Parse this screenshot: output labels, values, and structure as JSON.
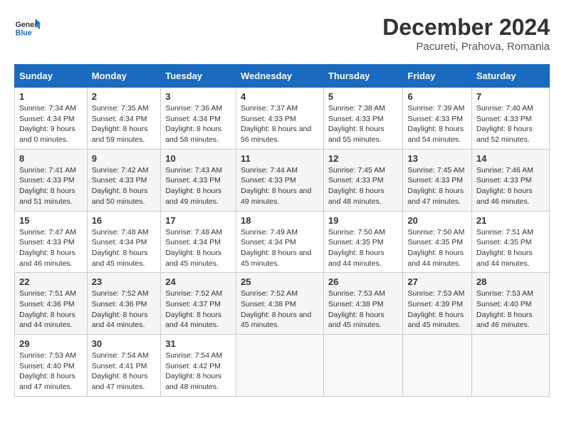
{
  "header": {
    "logo_line1": "General",
    "logo_line2": "Blue",
    "title": "December 2024",
    "subtitle": "Pacureti, Prahova, Romania"
  },
  "columns": [
    "Sunday",
    "Monday",
    "Tuesday",
    "Wednesday",
    "Thursday",
    "Friday",
    "Saturday"
  ],
  "weeks": [
    [
      {
        "day": "1",
        "info": "Sunrise: 7:34 AM\nSunset: 4:34 PM\nDaylight: 9 hours\nand 0 minutes."
      },
      {
        "day": "2",
        "info": "Sunrise: 7:35 AM\nSunset: 4:34 PM\nDaylight: 8 hours\nand 59 minutes."
      },
      {
        "day": "3",
        "info": "Sunrise: 7:36 AM\nSunset: 4:34 PM\nDaylight: 8 hours\nand 58 minutes."
      },
      {
        "day": "4",
        "info": "Sunrise: 7:37 AM\nSunset: 4:33 PM\nDaylight: 8 hours\nand 56 minutes."
      },
      {
        "day": "5",
        "info": "Sunrise: 7:38 AM\nSunset: 4:33 PM\nDaylight: 8 hours\nand 55 minutes."
      },
      {
        "day": "6",
        "info": "Sunrise: 7:39 AM\nSunset: 4:33 PM\nDaylight: 8 hours\nand 54 minutes."
      },
      {
        "day": "7",
        "info": "Sunrise: 7:40 AM\nSunset: 4:33 PM\nDaylight: 8 hours\nand 52 minutes."
      }
    ],
    [
      {
        "day": "8",
        "info": "Sunrise: 7:41 AM\nSunset: 4:33 PM\nDaylight: 8 hours\nand 51 minutes."
      },
      {
        "day": "9",
        "info": "Sunrise: 7:42 AM\nSunset: 4:33 PM\nDaylight: 8 hours\nand 50 minutes."
      },
      {
        "day": "10",
        "info": "Sunrise: 7:43 AM\nSunset: 4:33 PM\nDaylight: 8 hours\nand 49 minutes."
      },
      {
        "day": "11",
        "info": "Sunrise: 7:44 AM\nSunset: 4:33 PM\nDaylight: 8 hours\nand 49 minutes."
      },
      {
        "day": "12",
        "info": "Sunrise: 7:45 AM\nSunset: 4:33 PM\nDaylight: 8 hours\nand 48 minutes."
      },
      {
        "day": "13",
        "info": "Sunrise: 7:45 AM\nSunset: 4:33 PM\nDaylight: 8 hours\nand 47 minutes."
      },
      {
        "day": "14",
        "info": "Sunrise: 7:46 AM\nSunset: 4:33 PM\nDaylight: 8 hours\nand 46 minutes."
      }
    ],
    [
      {
        "day": "15",
        "info": "Sunrise: 7:47 AM\nSunset: 4:33 PM\nDaylight: 8 hours\nand 46 minutes."
      },
      {
        "day": "16",
        "info": "Sunrise: 7:48 AM\nSunset: 4:34 PM\nDaylight: 8 hours\nand 45 minutes."
      },
      {
        "day": "17",
        "info": "Sunrise: 7:48 AM\nSunset: 4:34 PM\nDaylight: 8 hours\nand 45 minutes."
      },
      {
        "day": "18",
        "info": "Sunrise: 7:49 AM\nSunset: 4:34 PM\nDaylight: 8 hours\nand 45 minutes."
      },
      {
        "day": "19",
        "info": "Sunrise: 7:50 AM\nSunset: 4:35 PM\nDaylight: 8 hours\nand 44 minutes."
      },
      {
        "day": "20",
        "info": "Sunrise: 7:50 AM\nSunset: 4:35 PM\nDaylight: 8 hours\nand 44 minutes."
      },
      {
        "day": "21",
        "info": "Sunrise: 7:51 AM\nSunset: 4:35 PM\nDaylight: 8 hours\nand 44 minutes."
      }
    ],
    [
      {
        "day": "22",
        "info": "Sunrise: 7:51 AM\nSunset: 4:36 PM\nDaylight: 8 hours\nand 44 minutes."
      },
      {
        "day": "23",
        "info": "Sunrise: 7:52 AM\nSunset: 4:36 PM\nDaylight: 8 hours\nand 44 minutes."
      },
      {
        "day": "24",
        "info": "Sunrise: 7:52 AM\nSunset: 4:37 PM\nDaylight: 8 hours\nand 44 minutes."
      },
      {
        "day": "25",
        "info": "Sunrise: 7:52 AM\nSunset: 4:38 PM\nDaylight: 8 hours\nand 45 minutes."
      },
      {
        "day": "26",
        "info": "Sunrise: 7:53 AM\nSunset: 4:38 PM\nDaylight: 8 hours\nand 45 minutes."
      },
      {
        "day": "27",
        "info": "Sunrise: 7:53 AM\nSunset: 4:39 PM\nDaylight: 8 hours\nand 45 minutes."
      },
      {
        "day": "28",
        "info": "Sunrise: 7:53 AM\nSunset: 4:40 PM\nDaylight: 8 hours\nand 46 minutes."
      }
    ],
    [
      {
        "day": "29",
        "info": "Sunrise: 7:53 AM\nSunset: 4:40 PM\nDaylight: 8 hours\nand 47 minutes."
      },
      {
        "day": "30",
        "info": "Sunrise: 7:54 AM\nSunset: 4:41 PM\nDaylight: 8 hours\nand 47 minutes."
      },
      {
        "day": "31",
        "info": "Sunrise: 7:54 AM\nSunset: 4:42 PM\nDaylight: 8 hours\nand 48 minutes."
      },
      null,
      null,
      null,
      null
    ]
  ]
}
